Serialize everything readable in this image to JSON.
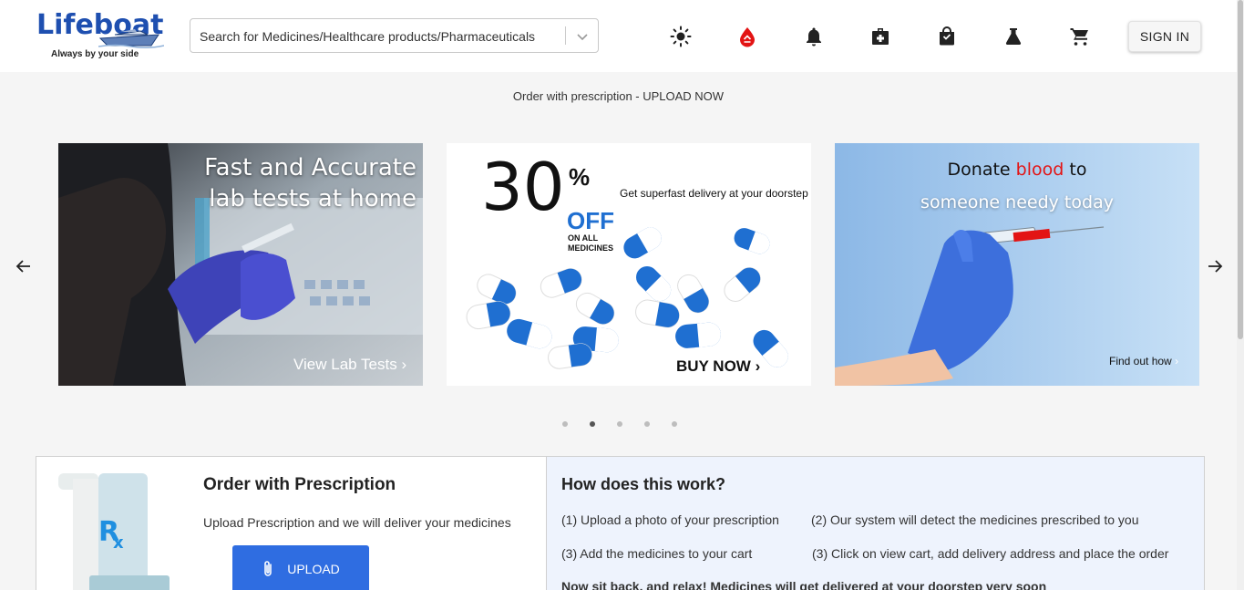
{
  "header": {
    "logo_text": "Lifeboat",
    "logo_tagline": "Always by your side",
    "search_placeholder": "Search for Medicines/Healthcare products/Pharmaceuticals",
    "icons": [
      "brightness-icon",
      "blood-drop-icon",
      "bell-icon",
      "medical-kit-icon",
      "shopping-bag-icon",
      "flask-icon",
      "cart-icon"
    ],
    "signin_label": "SIGN IN"
  },
  "promo": {
    "text": "Order with prescription - UPLOAD NOW"
  },
  "carousel": {
    "banners": [
      {
        "headline_1": "Fast and Accurate",
        "headline_2": "lab tests at home",
        "cta": "View Lab Tests"
      },
      {
        "big": "30",
        "percent": "%",
        "off": "OFF",
        "sub_1": "ON ALL",
        "sub_2": "MEDICINES",
        "tagline": "Get superfast delivery at your doorstep",
        "cta": "BUY NOW"
      },
      {
        "headline_1a": "Donate ",
        "headline_1b": "blood",
        "headline_1c": " to",
        "headline_2": "someone needy today",
        "cta": "Find out how"
      }
    ],
    "dot_count": 5,
    "active_dot": 1
  },
  "order_panel": {
    "title": "Order with Prescription",
    "description": "Upload Prescription and we will deliver your medicines",
    "upload_label": "UPLOAD"
  },
  "how_panel": {
    "title": "How does this work?",
    "step1": "(1) Upload a photo of your prescription",
    "step2": "(2) Our system will detect the medicines prescribed to you",
    "step3": "(3) Add the medicines to your cart",
    "step4": "(3) Click on view cart, add delivery address and place the order",
    "footer": "Now sit back, and relax! Medicines will get delivered at your doorstep very soon"
  },
  "colors": {
    "brand_blue": "#1e4fb0",
    "upload_blue": "#2f6de1",
    "blood_red": "#e31414",
    "panel_bg": "#eef3fd"
  }
}
